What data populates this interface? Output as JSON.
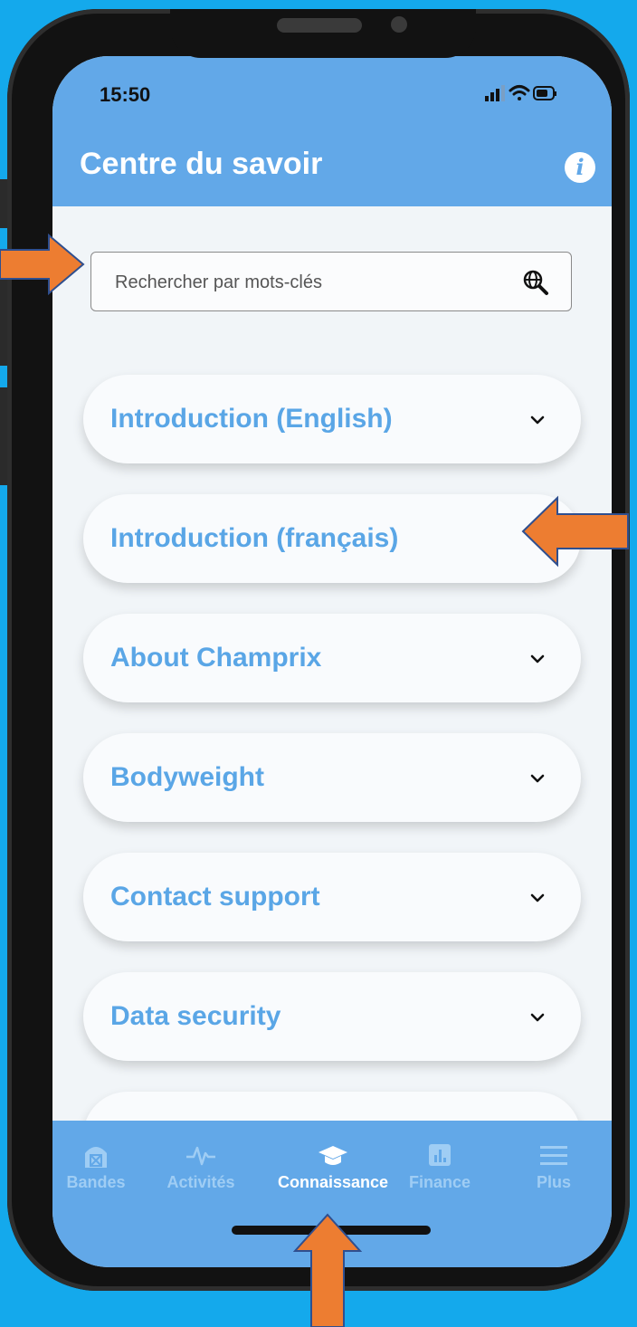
{
  "status_bar": {
    "time": "15:50"
  },
  "header": {
    "title": "Centre du savoir",
    "info_icon": "info-icon"
  },
  "search": {
    "placeholder": "Rechercher par mots-clés",
    "icon": "search-globe-icon"
  },
  "accordion_items": [
    {
      "label": "Introduction (English)"
    },
    {
      "label": "Introduction (français)"
    },
    {
      "label": "About Champrix"
    },
    {
      "label": "Bodyweight"
    },
    {
      "label": "Contact support"
    },
    {
      "label": "Data security"
    }
  ],
  "tabbar": {
    "tabs": [
      {
        "label": "Bandes",
        "icon": "barn-icon"
      },
      {
        "label": "Activités",
        "icon": "pulse-icon"
      },
      {
        "label": "Connaissance",
        "icon": "graduation-cap-icon",
        "active": true
      },
      {
        "label": "Finance",
        "icon": "bar-chart-icon"
      },
      {
        "label": "Plus",
        "icon": "menu-icon"
      }
    ]
  },
  "colors": {
    "background": "#14a9ec",
    "header": "#62a8e8",
    "accent_text": "#5aa6e6",
    "annotation_arrow": "#ed7d31"
  }
}
